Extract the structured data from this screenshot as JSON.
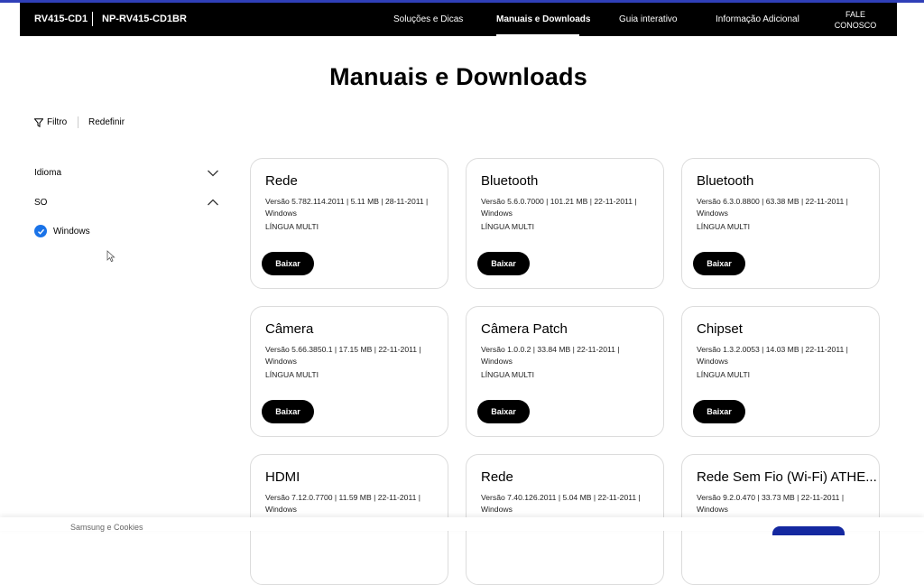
{
  "header": {
    "model_primary": "RV415-CD1",
    "model_secondary": "NP-RV415-CD1BR",
    "nav": [
      {
        "label": "Soluções e Dicas"
      },
      {
        "label": "Manuais e Downloads"
      },
      {
        "label": "Guia interativo"
      },
      {
        "label": "Informação Adicional"
      }
    ],
    "contact_line1": "FALE",
    "contact_line2": "CONOSCO"
  },
  "page": {
    "title": "Manuais e Downloads"
  },
  "filter": {
    "label": "Filtro",
    "reset": "Redefinir"
  },
  "sidebar": {
    "groups": [
      {
        "label": "Idioma",
        "state": "collapsed"
      },
      {
        "label": "SO",
        "state": "expanded"
      }
    ],
    "os_option": "Windows"
  },
  "cards": [
    {
      "title": "Rede",
      "info": "Versão 5.782.114.2011 | 5.11 MB | 28-11-2011 | Windows",
      "lang": "LÍNGUA MULTI",
      "button": "Baixar"
    },
    {
      "title": "Bluetooth",
      "info": "Versão 5.6.0.7000 | 101.21 MB | 22-11-2011 | Windows",
      "lang": "LÍNGUA MULTI",
      "button": "Baixar"
    },
    {
      "title": "Bluetooth",
      "info": "Versão 6.3.0.8800 | 63.38 MB | 22-11-2011 | Windows",
      "lang": "LÍNGUA MULTI",
      "button": "Baixar"
    },
    {
      "title": "Câmera",
      "info": "Versão 5.66.3850.1 | 17.15 MB | 22-11-2011 | Windows",
      "lang": "LÍNGUA MULTI",
      "button": "Baixar"
    },
    {
      "title": "Câmera Patch",
      "info": "Versão 1.0.0.2 | 33.84 MB | 22-11-2011 | Windows",
      "lang": "LÍNGUA MULTI",
      "button": "Baixar"
    },
    {
      "title": "Chipset",
      "info": "Versão 1.3.2.0053 | 14.03 MB | 22-11-2011 | Windows",
      "lang": "LÍNGUA MULTI",
      "button": "Baixar"
    },
    {
      "title": "HDMI",
      "info": "Versão 7.12.0.7700 | 11.59 MB | 22-11-2011 | Windows",
      "lang": "",
      "button": ""
    },
    {
      "title": "Rede",
      "info": "Versão 7.40.126.2011 | 5.04 MB | 22-11-2011 | Windows",
      "lang": "",
      "button": ""
    },
    {
      "title": "Rede Sem Fio (Wi-Fi) ATHE...",
      "info": "Versão 9.2.0.470 | 33.73 MB | 22-11-2011 | Windows",
      "lang": "",
      "button": ""
    }
  ],
  "cookie": {
    "text": "Samsung e Cookies"
  },
  "colors": {
    "nav_bg": "#000000",
    "accent_blue": "#1a73e8",
    "cookie_button": "#1428a0"
  }
}
